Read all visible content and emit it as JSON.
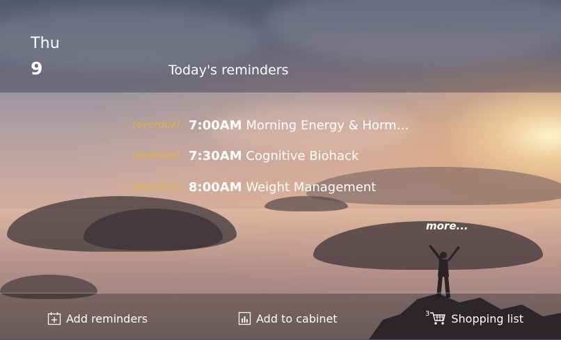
{
  "header": {
    "day_name": "Thu",
    "day_number": "9",
    "section_title": "Today's reminders"
  },
  "reminders": [
    {
      "status": "(overdue)",
      "time": "7:00AM",
      "title": "Morning Energy & Hormo..."
    },
    {
      "status": "(overdue)",
      "time": "7:30AM",
      "title": "Cognitive Biohack"
    },
    {
      "status": "(overdue)",
      "time": "8:00AM",
      "title": "Weight Management"
    }
  ],
  "more_label": "more...",
  "actions": {
    "add_reminders": {
      "label": "Add reminders",
      "icon": "calendar-plus-icon"
    },
    "add_to_cabinet": {
      "label": "Add to cabinet",
      "icon": "cabinet-icon"
    },
    "shopping_list": {
      "label": "Shopping list",
      "icon": "cart-icon",
      "count": "3"
    }
  },
  "colors": {
    "overdue": "#e8b04a",
    "text": "#ffffff"
  }
}
